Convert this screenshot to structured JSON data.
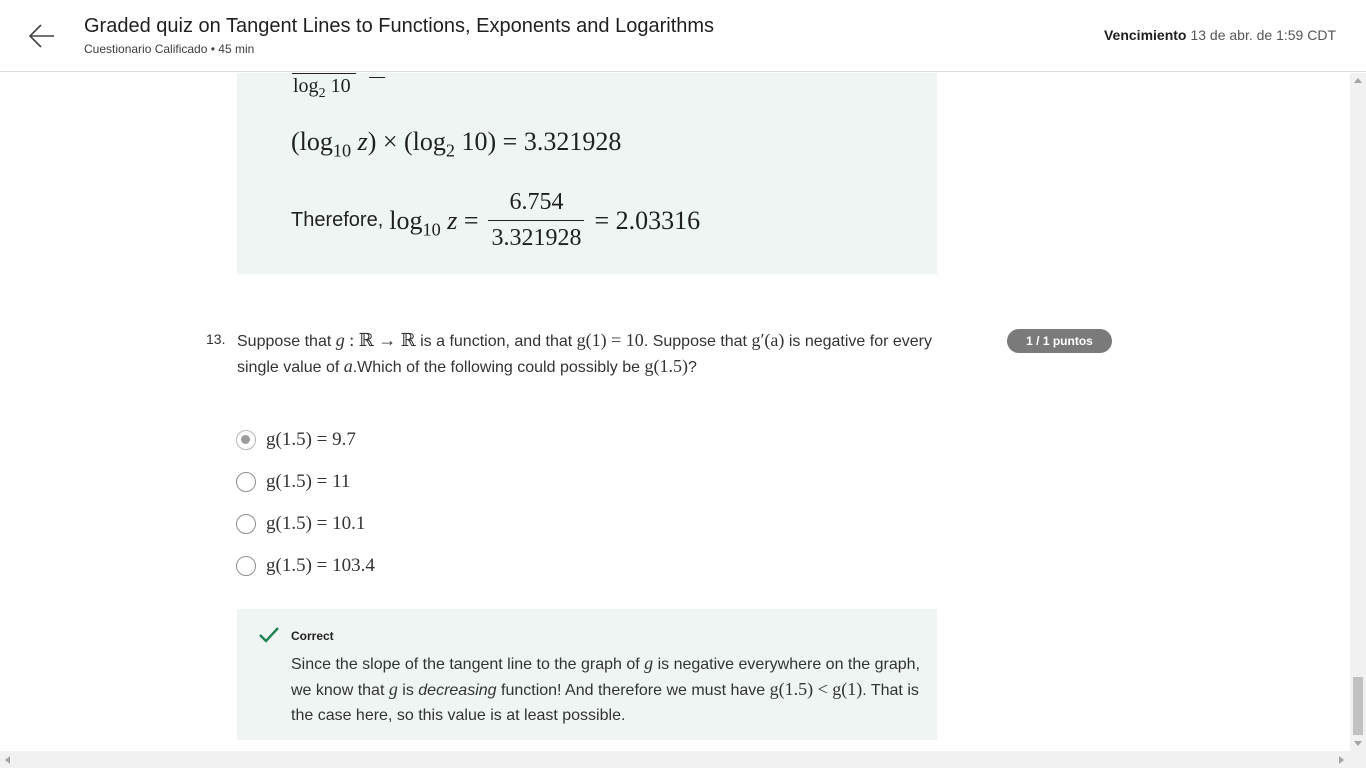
{
  "header": {
    "title": "Graded quiz on Tangent Lines to Functions, Exponents and Logarithms",
    "subtitle": "Cuestionario Calificado • 45 min",
    "due_label": "Vencimiento",
    "due_value": "13 de abr. de 1:59 CDT"
  },
  "explanation": {
    "partial_denominator": "log",
    "partial_denominator_sub": "2",
    "partial_denominator_rest": " 10",
    "line1": {
      "a": "(log",
      "a_sub": "10",
      "a_var": " z",
      "b": ") × (log",
      "b_sub": "2",
      "c": " 10) = 3.321928"
    },
    "line2": {
      "text": "Therefore,",
      "lhs": "log",
      "lhs_sub": "10",
      "lhs_var": " z",
      "eq": " =",
      "numerator": "6.754",
      "denominator": "3.321928",
      "result": "= 2.03316"
    }
  },
  "question": {
    "number": "13.",
    "points": "1 / 1 puntos",
    "text_parts": {
      "p1": "Suppose that ",
      "g1": "g",
      "m1": " : ℝ → ℝ",
      "p2": " is a function, and that ",
      "m2": "g(1) = 10",
      "p3": ". Suppose that ",
      "m3": "g′(a)",
      "p4": " is negative for every single value of ",
      "m4": "a",
      "p5": ".Which of the following could possibly be ",
      "m5": "g(1.5)",
      "p6": "?"
    },
    "options": [
      {
        "label": "g(1.5) = 9.7",
        "selected": true
      },
      {
        "label": "g(1.5) = 11",
        "selected": false
      },
      {
        "label": "g(1.5) = 10.1",
        "selected": false
      },
      {
        "label": "g(1.5) = 103.4",
        "selected": false
      }
    ]
  },
  "feedback": {
    "status": "Correct",
    "parts": {
      "p1": "Since the slope of the tangent line to the graph of ",
      "g1": "g",
      "p2": " is negative everywhere on the graph, we know that ",
      "g2": "g",
      "p3": " is ",
      "em": "decreasing",
      "p4": " function! And therefore we must have ",
      "m1": "g(1.5) < g(1)",
      "p5": ". That is the case here, so this value is at least possible."
    }
  },
  "colors": {
    "accent_green": "#1f8354",
    "box_background": "#eef5f3",
    "points_badge": "#7a7a7a"
  },
  "icons": {
    "back": "arrow-left-icon",
    "check": "check-icon"
  }
}
